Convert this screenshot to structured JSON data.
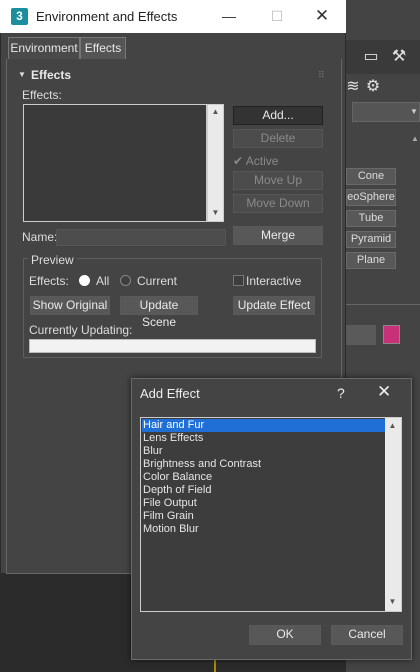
{
  "env_window": {
    "title": "Environment and Effects",
    "app_icon_label": "3",
    "tabs": [
      {
        "label": "Environment"
      },
      {
        "label": "Effects"
      }
    ],
    "rollout_title": "Effects",
    "effects_label": "Effects:",
    "buttons": {
      "add": "Add...",
      "delete": "Delete",
      "active": "Active",
      "move_up": "Move Up",
      "move_down": "Move Down",
      "merge": "Merge"
    },
    "name_label": "Name:",
    "name_value": "",
    "preview": {
      "title": "Preview",
      "effects_label": "Effects:",
      "radio_all": "All",
      "radio_current": "Current",
      "interactive": "Interactive",
      "show_original": "Show Original",
      "update_scene": "Update Scene",
      "update_effect": "Update Effect",
      "currently_updating": "Currently Updating:",
      "progress": 0
    }
  },
  "add_effect": {
    "title": "Add Effect",
    "help": "?",
    "effects": [
      "Hair and Fur",
      "Lens Effects",
      "Blur",
      "Brightness and Contrast",
      "Color Balance",
      "Depth of Field",
      "File Output",
      "Film Grain",
      "Motion Blur"
    ],
    "selected_index": 0,
    "ok": "OK",
    "cancel": "Cancel"
  },
  "background": {
    "objects": [
      "Cone",
      "eoSphere",
      "Tube",
      "Pyramid",
      "Plane"
    ],
    "color_swatch": "#c8317a"
  },
  "colors": {
    "selection": "#1f6fd6",
    "progress": "#1f8fff"
  }
}
